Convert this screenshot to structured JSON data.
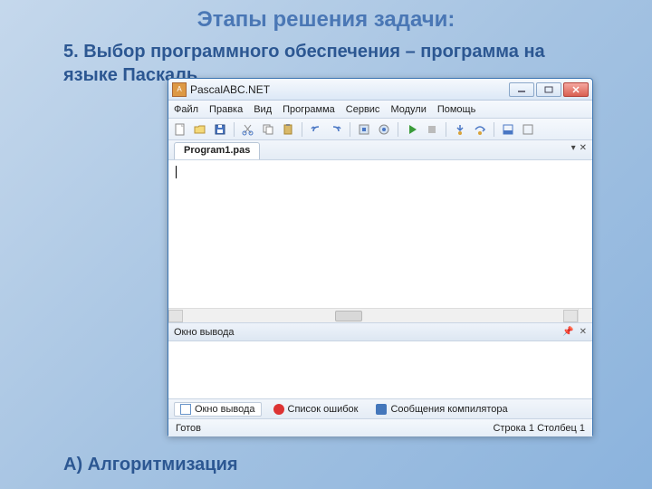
{
  "slide": {
    "title": "Этапы решения задачи:",
    "line1": "5. Выбор программного обеспечения – программа на языке Паскаль",
    "line2": "А) Алгоритмизация"
  },
  "window": {
    "title": "PascalABC.NET",
    "menu": {
      "file": "Файл",
      "edit": "Правка",
      "view": "Вид",
      "program": "Программа",
      "service": "Сервис",
      "modules": "Модули",
      "help": "Помощь"
    },
    "tab": {
      "label": "Program1.pas"
    },
    "output_panel": {
      "title": "Окно вывода"
    },
    "bottom_tabs": {
      "output": "Окно вывода",
      "errors": "Список ошибок",
      "compiler": "Сообщения компилятора"
    },
    "status": {
      "ready": "Готов",
      "pos": "Строка 1 Столбец 1"
    }
  }
}
